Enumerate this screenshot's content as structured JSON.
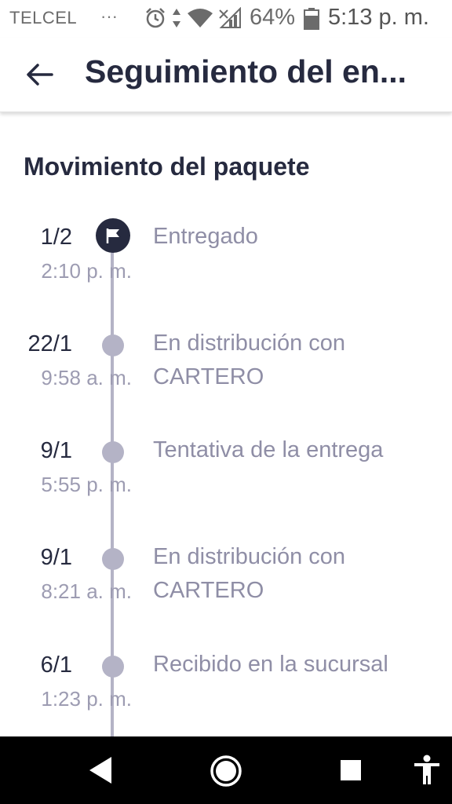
{
  "status_bar": {
    "carrier": "TELCEL",
    "overflow": "···",
    "battery_percent": "64%",
    "time": "5:13 p. m.",
    "icons": [
      "alarm-icon",
      "data-arrows-icon",
      "wifi-icon",
      "signal-icon",
      "battery-icon"
    ]
  },
  "app_bar": {
    "title": "Seguimiento del en..."
  },
  "tracking": {
    "section_title": "Movimiento del paquete",
    "events": [
      {
        "date": "1/2",
        "time": "2:10 p. m.",
        "description": "Entregado",
        "current": true
      },
      {
        "date": "22/1",
        "time": "9:58 a. m.",
        "description": "En distribución con CARTERO",
        "current": false
      },
      {
        "date": "9/1",
        "time": "5:55 p. m.",
        "description": "Tentativa de la entrega",
        "current": false
      },
      {
        "date": "9/1",
        "time": "8:21 a. m.",
        "description": "En distribución con CARTERO",
        "current": false
      },
      {
        "date": "6/1",
        "time": "1:23 p. m.",
        "description": "Recibido en la sucursal",
        "current": false
      }
    ]
  },
  "nav_bar": {
    "buttons": [
      "back-triangle-icon",
      "home-circle-icon",
      "recents-square-icon",
      "accessibility-icon"
    ]
  },
  "colors": {
    "text_dark": "#262a3f",
    "text_muted": "#8f8ea6",
    "timeline": "#b4b3c6",
    "nav_background": "#000000"
  }
}
